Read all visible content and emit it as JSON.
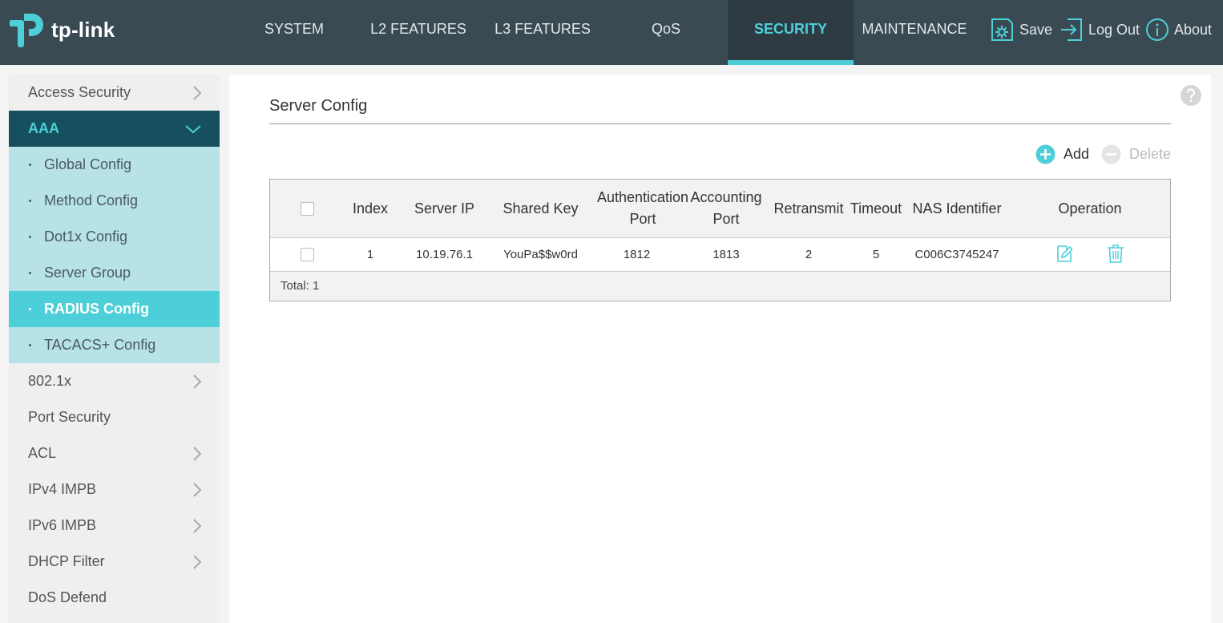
{
  "brand": {
    "logo_text": "tp-link"
  },
  "nav": {
    "tabs": [
      {
        "label": "SYSTEM"
      },
      {
        "label": "L2 FEATURES"
      },
      {
        "label": "L3 FEATURES"
      },
      {
        "label": "QoS"
      },
      {
        "label": "SECURITY",
        "active": true
      },
      {
        "label": "MAINTENANCE"
      }
    ],
    "save_label": "Save",
    "logout_label": "Log Out",
    "about_label": "About"
  },
  "sidebar": {
    "items": [
      {
        "label": "Access Security",
        "icon": "chevron-right-icon"
      },
      {
        "label": "AAA",
        "icon": "chevron-down-icon",
        "expanded": true,
        "children": [
          {
            "label": "Global Config"
          },
          {
            "label": "Method Config"
          },
          {
            "label": "Dot1x Config"
          },
          {
            "label": "Server Group"
          },
          {
            "label": "RADIUS Config",
            "active": true
          },
          {
            "label": "TACACS+ Config"
          }
        ]
      },
      {
        "label": "802.1x",
        "icon": "chevron-right-icon"
      },
      {
        "label": "Port Security"
      },
      {
        "label": "ACL",
        "icon": "chevron-right-icon"
      },
      {
        "label": "IPv4 IMPB",
        "icon": "chevron-right-icon"
      },
      {
        "label": "IPv6 IMPB",
        "icon": "chevron-right-icon"
      },
      {
        "label": "DHCP Filter",
        "icon": "chevron-right-icon"
      },
      {
        "label": "DoS Defend"
      }
    ]
  },
  "main": {
    "section_title": "Server Config",
    "add_label": "Add",
    "delete_label": "Delete",
    "table": {
      "headers": {
        "index": "Index",
        "server_ip": "Server IP",
        "shared_key": "Shared Key",
        "auth_port_1": "Authentication",
        "auth_port_2": "Port",
        "acct_port_1": "Accounting",
        "acct_port_2": "Port",
        "retransmit": "Retransmit",
        "timeout": "Timeout",
        "nas_identifier": "NAS Identifier",
        "operation": "Operation"
      },
      "rows": [
        {
          "index": "1",
          "server_ip": "10.19.76.1",
          "shared_key": "YouPa$$w0rd",
          "auth_port": "1812",
          "acct_port": "1813",
          "retransmit": "2",
          "timeout": "5",
          "nas_identifier": "C006C3745247"
        }
      ],
      "total_text": "Total: 1"
    }
  },
  "colors": {
    "header_bg": "#3a4a53",
    "accent": "#4dcfd9",
    "group_open_bg": "#164f5e",
    "submenu_bg": "#b7e2e6"
  }
}
